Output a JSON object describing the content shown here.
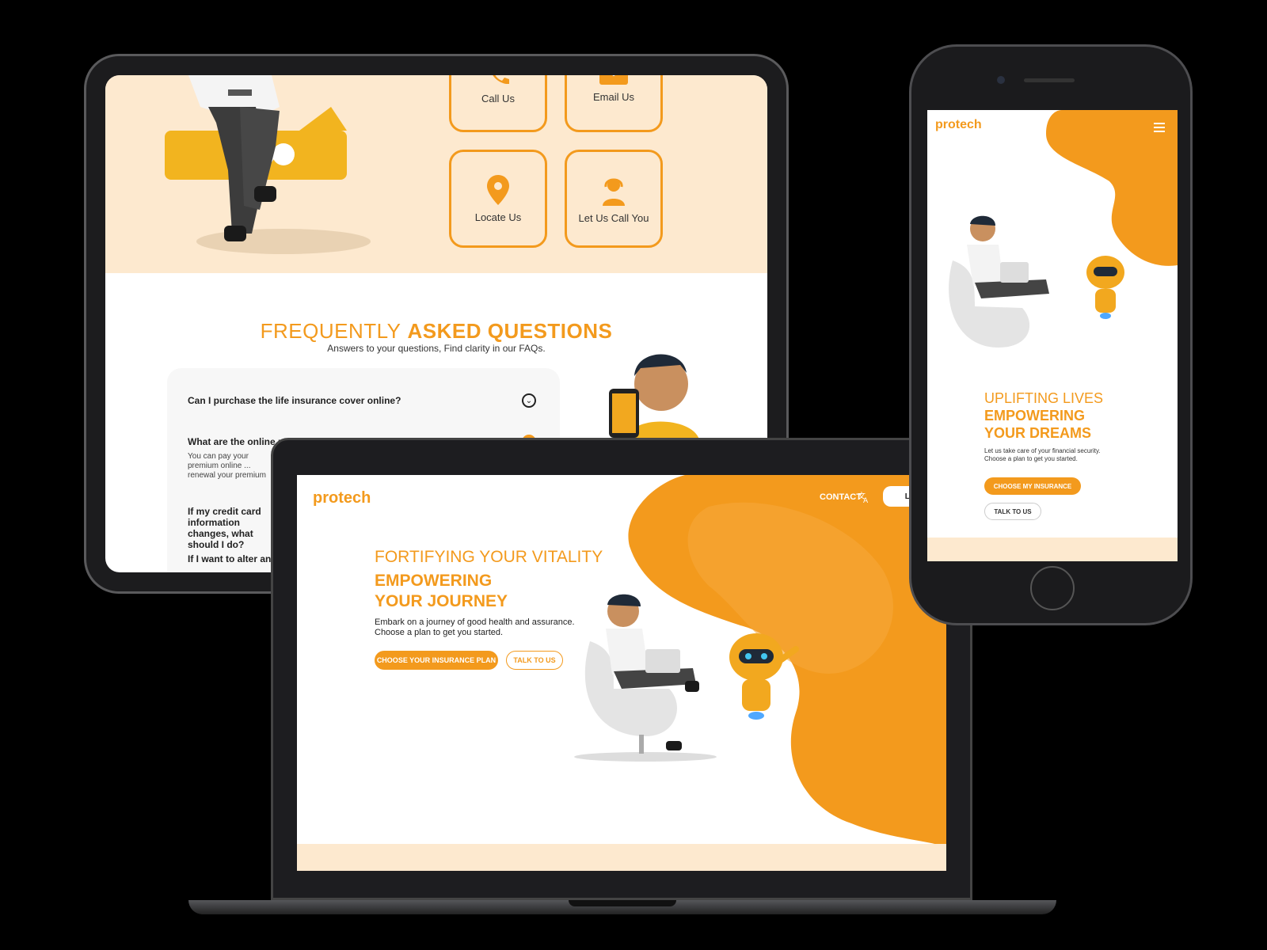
{
  "brand": {
    "logo_text": "protech",
    "accent": "#f39a1d",
    "light_bg": "#fde9cf"
  },
  "tablet": {
    "contact_cards": [
      {
        "label": "Call Us",
        "icon": "phone-icon"
      },
      {
        "label": "Email Us",
        "icon": "email-icon"
      },
      {
        "label": "Locate Us",
        "icon": "location-pin-icon"
      },
      {
        "label": "Let Us Call You",
        "icon": "support-agent-icon"
      }
    ],
    "faq": {
      "title_light": "FREQUENTLY",
      "title_bold": "ASKED QUESTIONS",
      "subtitle": "Answers to your questions, Find clarity in our FAQs.",
      "items": [
        {
          "question": "Can I purchase the life insurance cover online?"
        },
        {
          "question": "What are the online premium payment options?",
          "answer": "You can pay your premium online ... renewal your premium would be attached to the policy."
        },
        {
          "question": "If my credit card information changes, what should I do?"
        },
        {
          "question": "If I want to alter any terms of my policy"
        }
      ]
    }
  },
  "phone": {
    "hero_light": "UPLIFTING LIVES",
    "hero_bold_1": "EMPOWERING",
    "hero_bold_2": "YOUR DREAMS",
    "desc_1": "Let us take care of your financial security.",
    "desc_2": "Choose a plan to get you started.",
    "primary_btn": "CHOOSE MY INSURANCE",
    "secondary_btn": "TALK TO US",
    "menu_icon": "hamburger-menu-icon"
  },
  "laptop": {
    "nav": {
      "contact": "CONTACT",
      "translate_icon": "translate-icon",
      "login": "LOG IN"
    },
    "hero_light": "FORTIFYING YOUR VITALITY",
    "hero_bold_1": "EMPOWERING",
    "hero_bold_2": "YOUR JOURNEY",
    "desc_1": "Embark on a journey of good health and assurance.",
    "desc_2": "Choose a plan to get you started.",
    "primary_btn": "CHOOSE YOUR INSURANCE PLAN",
    "secondary_btn": "TALK TO US"
  }
}
